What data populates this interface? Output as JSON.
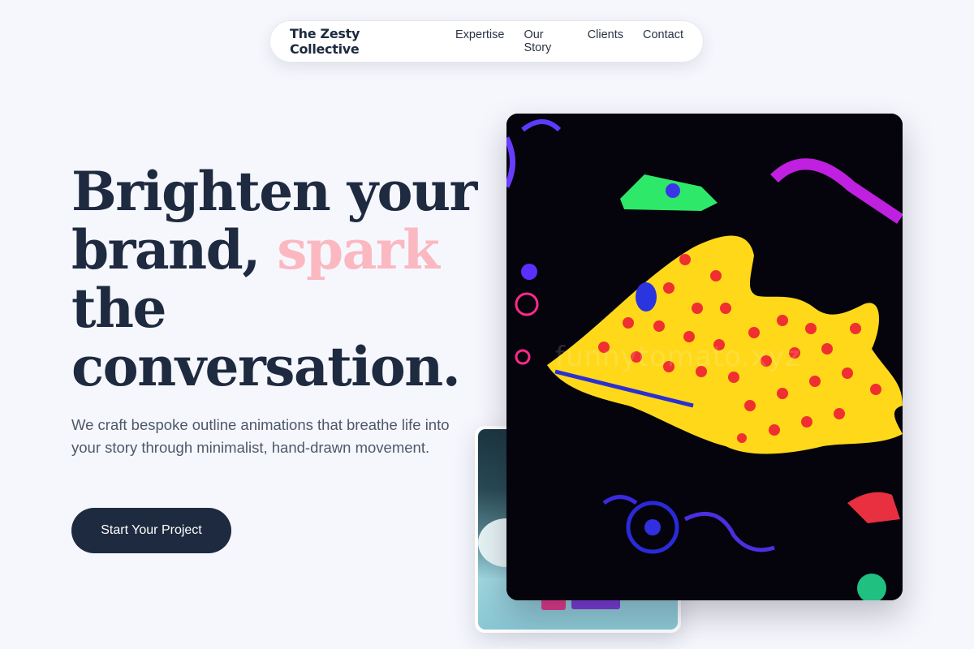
{
  "nav": {
    "brand": "The Zesty Collective",
    "links": [
      "Expertise",
      "Our Story",
      "Clients",
      "Contact"
    ]
  },
  "hero": {
    "headline_part1": "Brighten your brand, ",
    "headline_accent": "spark",
    "headline_part2": " the conversation.",
    "subtext": "We craft bespoke outline animations that breathe life into your story through minimalist, hand-drawn movement.",
    "cta_label": "Start Your Project"
  },
  "media": {
    "watermark": "funnytomato.xyz"
  },
  "colors": {
    "background": "#f6f7fd",
    "ink": "#1e2a3f",
    "accent": "#fbb8c1",
    "muted": "#4d586a"
  }
}
